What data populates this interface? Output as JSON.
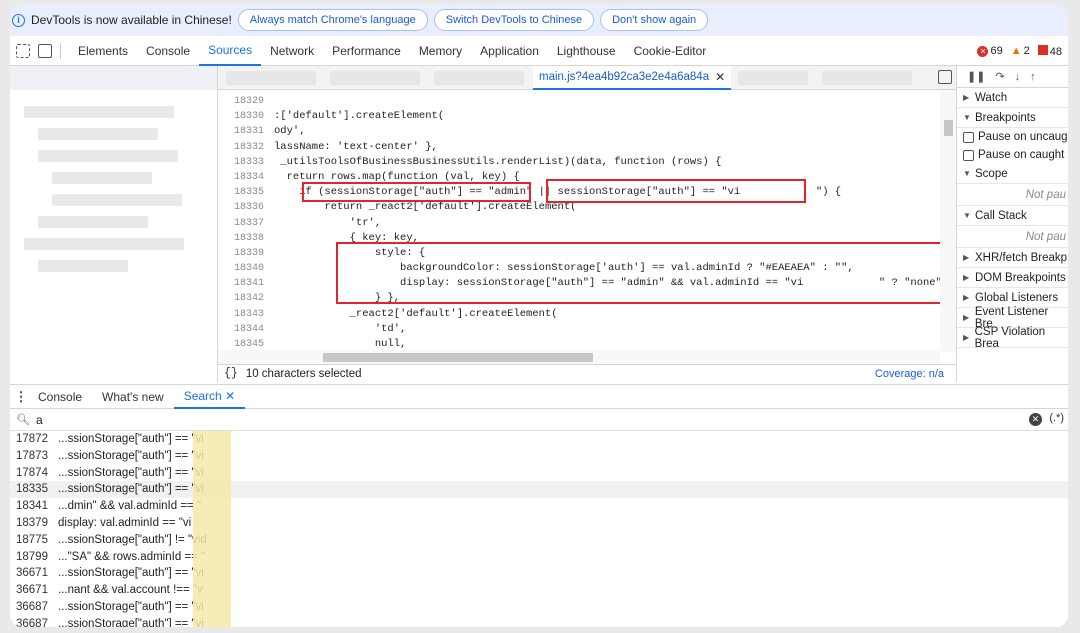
{
  "infobar": {
    "message": "DevTools is now available in Chinese!",
    "buttons": [
      "Always match Chrome's language",
      "Switch DevTools to Chinese",
      "Don't show again"
    ]
  },
  "toolbar": {
    "tabs": [
      "Elements",
      "Console",
      "Sources",
      "Network",
      "Performance",
      "Memory",
      "Application",
      "Lighthouse",
      "Cookie-Editor"
    ],
    "active_tab": "Sources",
    "errors": "69",
    "warnings": "2",
    "issues": "48"
  },
  "editor": {
    "file_tab": "main.js?4ea4b92ca3e2e4a6a84a",
    "lines": [
      {
        "n": "18329",
        "code": ""
      },
      {
        "n": "18330",
        "code": ":['default'].createElement("
      },
      {
        "n": "18331",
        "code": "ody',"
      },
      {
        "n": "18332",
        "code": "lassName: 'text-center' },"
      },
      {
        "n": "18333",
        "code": " _utilsToolsOfBusinessBusinessUtils.renderList)(data, function (rows) {"
      },
      {
        "n": "18334",
        "code": "  return rows.map(function (val, key) {"
      },
      {
        "n": "18335",
        "code": "    if (sessionStorage[\"auth\"] == \"admin\" || sessionStorage[\"auth\"] == \"vi            \") {"
      },
      {
        "n": "18336",
        "code": "        return _react2['default'].createElement("
      },
      {
        "n": "18337",
        "code": "            'tr',"
      },
      {
        "n": "18338",
        "code": "            { key: key,"
      },
      {
        "n": "18339",
        "code": "                style: {"
      },
      {
        "n": "18340",
        "code": "                    backgroundColor: sessionStorage['auth'] == val.adminId ? \"#EAEAEA\" : \"\","
      },
      {
        "n": "18341",
        "code": "                    display: sessionStorage[\"auth\"] == \"admin\" && val.adminId == \"vi            \" ? \"none\" : \"\""
      },
      {
        "n": "18342",
        "code": "                } },"
      },
      {
        "n": "18343",
        "code": "            _react2['default'].createElement("
      },
      {
        "n": "18344",
        "code": "                'td',"
      },
      {
        "n": "18345",
        "code": "                null,"
      }
    ],
    "status_text": "10 characters selected",
    "status_braces": "{}",
    "coverage": "Coverage: n/a"
  },
  "debugger": {
    "sections": {
      "watch": "Watch",
      "breakpoints": "Breakpoints",
      "pause_uncaught": "Pause on uncaug",
      "pause_caught": "Pause on caught",
      "scope": "Scope",
      "scope_status": "Not pau",
      "call_stack": "Call Stack",
      "call_stack_status": "Not pau",
      "xhr": "XHR/fetch Breakp",
      "dom": "DOM Breakpoints",
      "global": "Global Listeners",
      "event": "Event Listener Bre",
      "csp": "CSP Violation Brea"
    }
  },
  "drawer": {
    "tabs": [
      "Console",
      "What's new",
      "Search"
    ],
    "active_tab": "Search",
    "search_value": "a",
    "regex_label": "(.*)",
    "results": [
      {
        "n": "17872",
        "text": "...ssionStorage[\"auth\"] == \"vi"
      },
      {
        "n": "17873",
        "text": "...ssionStorage[\"auth\"] == \"vi"
      },
      {
        "n": "17874",
        "text": "...ssionStorage[\"auth\"] == \"vi"
      },
      {
        "n": "18335",
        "text": "...ssionStorage[\"auth\"] == \"vi"
      },
      {
        "n": "18341",
        "text": "...dmin\" && val.adminId == \""
      },
      {
        "n": "18379",
        "text": "display: val.adminId == \"vi"
      },
      {
        "n": "18775",
        "text": "...ssionStorage[\"auth\"] != \"vid"
      },
      {
        "n": "18799",
        "text": "...\"SA\" && rows.adminId == \""
      },
      {
        "n": "36671",
        "text": "...ssionStorage[\"auth\"] == \"vi"
      },
      {
        "n": "36671",
        "text": "...nant && val.account !== \"v"
      },
      {
        "n": "36687",
        "text": "...ssionStorage[\"auth\"] == \"vi"
      },
      {
        "n": "36687",
        "text": "...ssionStorage[\"auth\"] == \"vi"
      }
    ],
    "selected_index": 3
  }
}
